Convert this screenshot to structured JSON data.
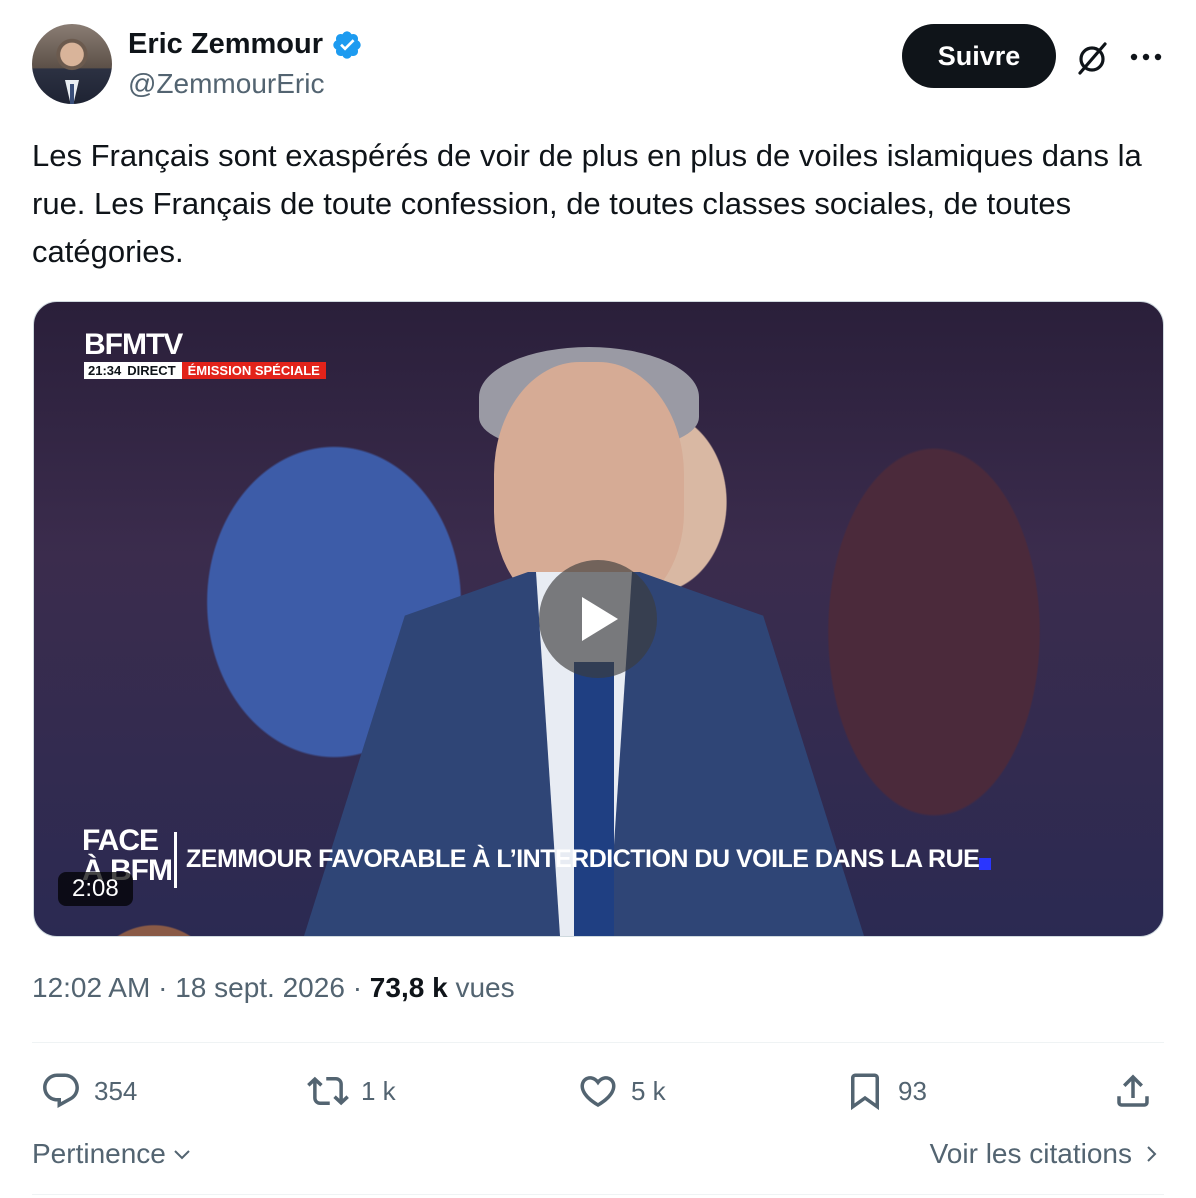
{
  "author": {
    "name": "Eric Zemmour",
    "handle": "@ZemmourEric",
    "verified_color": "#1d9bf0"
  },
  "header": {
    "follow_label": "Suivre",
    "icons": [
      "grok-icon",
      "more-icon"
    ]
  },
  "tweet": {
    "text": "Les Français sont exaspérés de voir de plus en plus de voiles islamiques dans la rue. Les Français de toute confession, de toutes classes sociales, de toutes catégories."
  },
  "media": {
    "channel": "BFMTV",
    "time": "21:34",
    "live_label": "DIRECT",
    "program_label": "ÉMISSION SPÉCIALE",
    "show_logo": "FACE À BFM",
    "ticker": "ZEMMOUR FAVORABLE À L’INTERDICTION DU VOILE DANS LA RUE",
    "duration": "2:08"
  },
  "meta": {
    "time": "12:02 AM",
    "separator": "·",
    "date": "18 sept. 2026",
    "views_count": "73,8 k",
    "views_label": "vues"
  },
  "actions": {
    "replies": "354",
    "reposts": "1 k",
    "likes": "5 k",
    "bookmarks": "93"
  },
  "footer": {
    "sort_label": "Pertinence",
    "quotes_label": "Voir les citations"
  }
}
